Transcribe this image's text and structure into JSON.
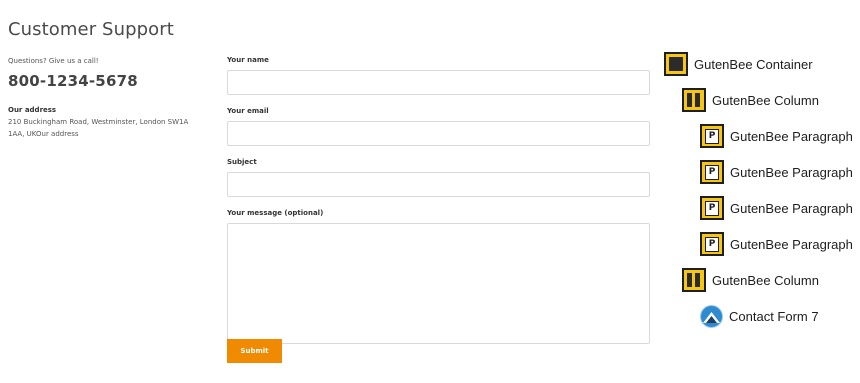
{
  "page": {
    "title": "Customer Support"
  },
  "contact_info": {
    "questions_text": "Questions? Give us a call!",
    "phone": "800-1234-5678",
    "address_label": "Our address",
    "address_text": "210 Buckingham Road, Westminster, London SW1A 1AA, UKOur address"
  },
  "form": {
    "name_label": "Your name",
    "name_value": "",
    "email_label": "Your email",
    "email_value": "",
    "subject_label": "Subject",
    "subject_value": "",
    "message_label": "Your message (optional)",
    "message_value": "",
    "submit_label": "Submit"
  },
  "block_tree": {
    "container_label": "GutenBee Container",
    "column1_label": "GutenBee Column",
    "paragraph1_label": "GutenBee Paragraph",
    "paragraph2_label": "GutenBee Paragraph",
    "paragraph3_label": "GutenBee Paragraph",
    "paragraph4_label": "GutenBee Paragraph",
    "column2_label": "GutenBee Column",
    "form_label": "Contact Form 7",
    "icons": {
      "container": "container-block-icon",
      "column": "column-block-icon",
      "paragraph": "paragraph-block-icon",
      "form": "contact-form-7-icon"
    }
  },
  "colors": {
    "accent_button": "#f08a00",
    "block_icon_fill": "#f5c518",
    "cf7_icon": "#2f8bd0"
  }
}
